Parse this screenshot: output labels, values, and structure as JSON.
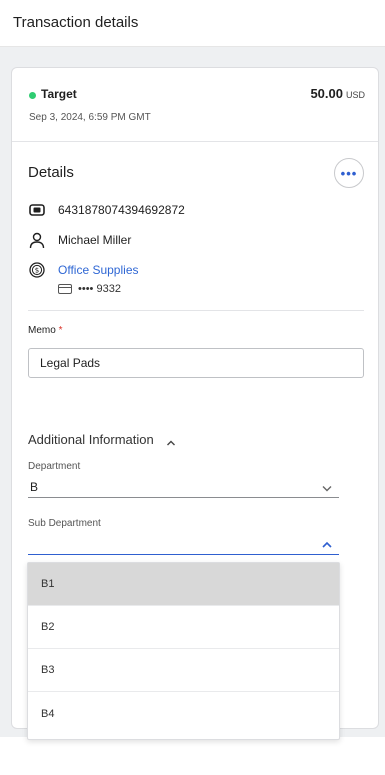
{
  "header": {
    "title": "Transaction details"
  },
  "transaction": {
    "merchant": "Target",
    "status_color": "#2ecc71",
    "amount": "50.00",
    "currency": "USD",
    "date": "Sep 3, 2024, 6:59 PM GMT"
  },
  "details": {
    "title": "Details",
    "more_label": "•••",
    "transaction_id": "6431878074394692872",
    "cardholder": "Michael Miller",
    "category": "Office Supplies",
    "card_number": "•••• 9332"
  },
  "memo": {
    "label": "Memo",
    "required_mark": "*",
    "value": "Legal Pads"
  },
  "additional": {
    "title": "Additional Information",
    "department_label": "Department",
    "department_value": "B",
    "sub_department_label": "Sub Department",
    "sub_department_value": "",
    "options": [
      "B1",
      "B2",
      "B3",
      "B4"
    ],
    "highlighted_option": "B1"
  },
  "colors": {
    "accent": "#2f5fd0",
    "link": "#2f67d4",
    "required": "#d93025"
  }
}
